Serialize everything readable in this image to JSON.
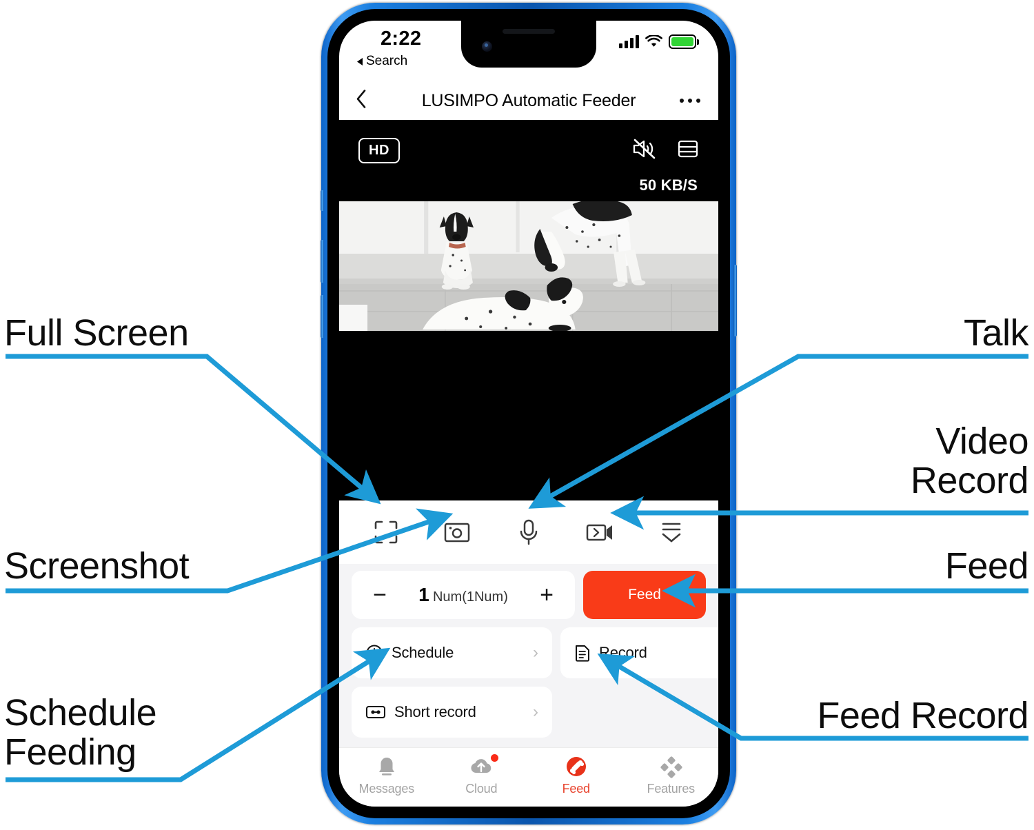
{
  "annotations": {
    "accent_color": "#1e9bd7",
    "items": [
      {
        "key": "full_screen",
        "label": "Full Screen",
        "side": "left"
      },
      {
        "key": "screenshot",
        "label": "Screenshot",
        "side": "left"
      },
      {
        "key": "schedule_feeding",
        "label": "Schedule\nFeeding",
        "side": "left"
      },
      {
        "key": "talk",
        "label": "Talk",
        "side": "right"
      },
      {
        "key": "video_record",
        "label": "Video\nRecord",
        "side": "right"
      },
      {
        "key": "feed",
        "label": "Feed",
        "side": "right"
      },
      {
        "key": "feed_record",
        "label": "Feed Record",
        "side": "right"
      }
    ]
  },
  "phone": {
    "frame_color": "#1b7fe0",
    "status_bar": {
      "time": "2:22",
      "back_to_app": "Search",
      "signal_icon": "cellular-bars-icon",
      "wifi_icon": "wifi-icon",
      "battery_icon": "battery-full-icon",
      "battery_color": "#31d435"
    },
    "nav_bar": {
      "back_icon": "chevron-left-icon",
      "title": "LUSIMPO Automatic Feeder",
      "more_icon": "ellipsis-icon"
    },
    "video": {
      "quality_badge": "HD",
      "mute_icon": "speaker-muted-icon",
      "layout_icon": "split-view-icon",
      "bitrate": "50 KB/S",
      "stream_alt": "three black and white dogs on tiled floor"
    },
    "controls": [
      {
        "key": "fullscreen",
        "icon": "fullscreen-corners-icon"
      },
      {
        "key": "screenshot",
        "icon": "camera-snapshot-icon"
      },
      {
        "key": "talk",
        "icon": "microphone-icon"
      },
      {
        "key": "video_record",
        "icon": "video-camera-icon"
      },
      {
        "key": "collapse",
        "icon": "collapse-panel-icon"
      }
    ],
    "feed_panel": {
      "minus": "−",
      "plus": "+",
      "amount": "1",
      "amount_unit": "Num(1Num)",
      "feed_button": "Feed",
      "feed_button_color": "#f93b18"
    },
    "cards": [
      {
        "key": "schedule",
        "icon": "clock-icon",
        "label": "Schedule",
        "chevron": "›"
      },
      {
        "key": "record",
        "icon": "document-icon",
        "label": "Record",
        "chevron": "›"
      },
      {
        "key": "short_record",
        "icon": "cassette-icon",
        "label": "Short record",
        "chevron": "›"
      }
    ],
    "tabs": [
      {
        "key": "messages",
        "icon": "bell-icon",
        "label": "Messages",
        "active": false,
        "badge": false
      },
      {
        "key": "cloud",
        "icon": "cloud-upload-icon",
        "label": "Cloud",
        "active": false,
        "badge": true
      },
      {
        "key": "feed",
        "icon": "bone-icon",
        "label": "Feed",
        "active": true,
        "badge": false
      },
      {
        "key": "features",
        "icon": "grid-diamond-icon",
        "label": "Features",
        "active": false,
        "badge": false
      }
    ]
  }
}
